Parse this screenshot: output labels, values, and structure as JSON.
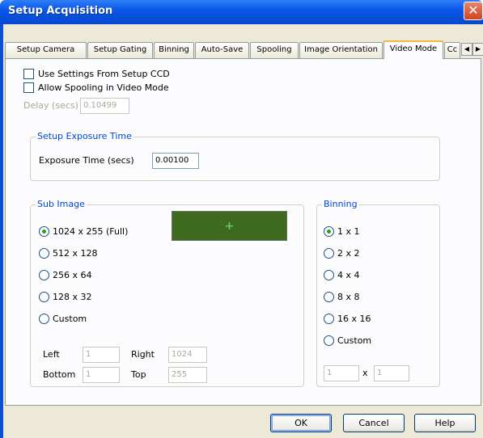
{
  "window": {
    "title": "Setup Acquisition",
    "close_label": "✕"
  },
  "tabs": [
    {
      "label": "Setup Camera"
    },
    {
      "label": "Setup Gating"
    },
    {
      "label": "Binning"
    },
    {
      "label": "Auto-Save"
    },
    {
      "label": "Spooling"
    },
    {
      "label": "Image Orientation"
    },
    {
      "label": "Video Mode"
    },
    {
      "label": "Cc"
    }
  ],
  "tab_scroll": {
    "left": "◀",
    "right": "▶"
  },
  "video_mode": {
    "use_settings_label": "Use Settings From Setup CCD",
    "allow_spooling_label": "Allow Spooling in Video Mode",
    "delay_label": "Delay (secs)",
    "delay_value": "0.10499"
  },
  "exposure": {
    "group_label": "Setup Exposure Time",
    "label": "Exposure Time (secs)",
    "value": "0.00100"
  },
  "sub_image": {
    "group_label": "Sub Image",
    "options": [
      "1024 x 255 (Full)",
      "512 x 128",
      "256 x 64",
      "128 x 32",
      "Custom"
    ],
    "selected": "1024 x 255 (Full)",
    "left_label": "Left",
    "left_value": "1",
    "right_label": "Right",
    "right_value": "1024",
    "bottom_label": "Bottom",
    "bottom_value": "1",
    "top_label": "Top",
    "top_value": "255",
    "preview_marker": "+"
  },
  "binning": {
    "group_label": "Binning",
    "options": [
      "1 x 1",
      "2 x 2",
      "4 x 4",
      "8 x 8",
      "16 x 16",
      "Custom"
    ],
    "selected": "1 x 1",
    "custom_x": "1",
    "custom_sep": "x",
    "custom_y": "1"
  },
  "buttons": {
    "ok": "OK",
    "cancel": "Cancel",
    "help": "Help"
  }
}
